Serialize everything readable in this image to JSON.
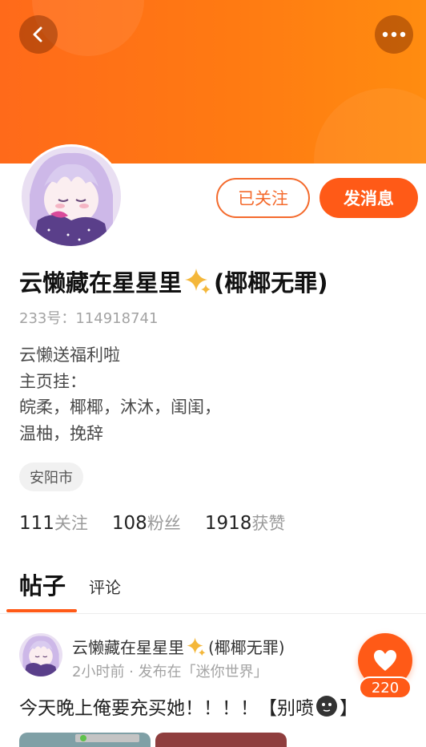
{
  "profile": {
    "follow_state_label": "已关注",
    "message_label": "发消息",
    "name_part1": "云懒藏在星星里",
    "name_part2": "(椰椰无罪)",
    "id_label": "233号：",
    "id_value": "114918741",
    "bio": [
      "云懒送福利啦",
      "主页挂：",
      "皖柔，椰椰，沐沐，闺闺，",
      "温柚，挽辞"
    ],
    "location": "安阳市"
  },
  "stats": [
    {
      "count": "111",
      "label": "关注"
    },
    {
      "count": "108",
      "label": "粉丝"
    },
    {
      "count": "1918",
      "label": "获赞"
    }
  ],
  "tabs": {
    "active": "帖子",
    "other": "评论"
  },
  "post": {
    "author_part1": "云懒藏在星星里",
    "author_part2": "(椰椰无罪)",
    "meta": "2小时前 · 发布在「迷你世界」",
    "text_before": "今天晚上俺要充买她！！！！【别喷",
    "text_after": "】",
    "like_count": "220"
  },
  "icons": {
    "back": "chevron-left-icon",
    "more": "more-dots-icon",
    "sparkle": "sparkle-icon",
    "heart": "heart-icon",
    "emoji": "dark-face-emoji-icon"
  },
  "colors": {
    "accent": "#ff5a17",
    "banner": "#ff7a12"
  }
}
